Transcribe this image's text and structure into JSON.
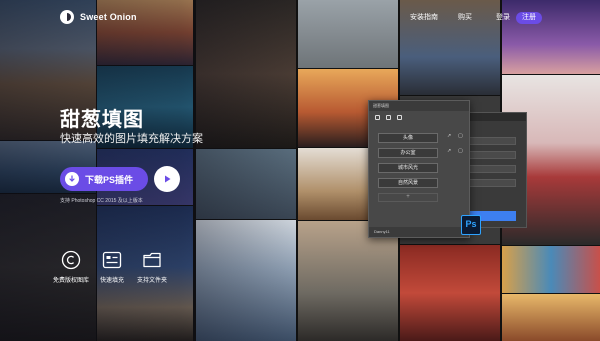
{
  "brand": {
    "name": "Sweet Onion"
  },
  "nav": [
    {
      "label": "安装指南"
    },
    {
      "label": "购买"
    },
    {
      "label": "登录"
    },
    {
      "label": "注册"
    }
  ],
  "hero": {
    "title": "甜葱填图",
    "subtitle": "快速高效的图片填充解决方案",
    "download_label": "下载PS插件",
    "support_text": "支持 Photoshop CC 2015 及以上版本"
  },
  "features": [
    {
      "label": "免费版权图库",
      "icon": "copyright-icon"
    },
    {
      "label": "快速填充",
      "icon": "fill-panel-icon"
    },
    {
      "label": "支持文件夹",
      "icon": "folder-icon"
    }
  ],
  "panel": {
    "title": "甜葱填图",
    "items": [
      {
        "label": "头像"
      },
      {
        "label": "办公室"
      },
      {
        "label": "城市风光"
      },
      {
        "label": "自然风景"
      }
    ],
    "add": "+",
    "user": "Danny11",
    "ps_badge": "Ps"
  },
  "colors": {
    "accent": "#6b4ce6",
    "ps_blue": "#2fa3ff"
  }
}
